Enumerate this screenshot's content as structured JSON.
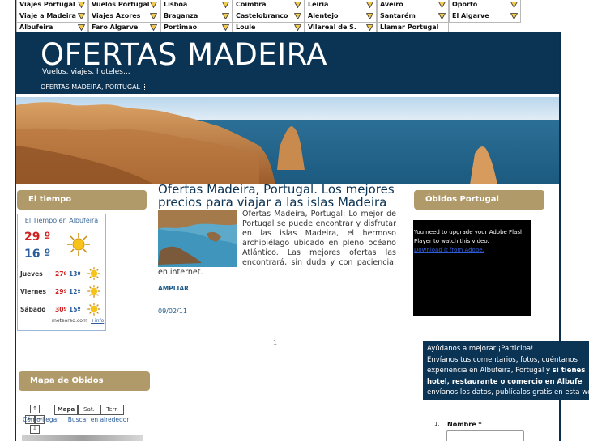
{
  "nav": {
    "rows": [
      [
        "Viajes Portugal",
        "Vuelos Portugal",
        "Lisboa",
        "Coimbra",
        "Leiria",
        "Aveiro",
        "Oporto"
      ],
      [
        "Viaje a Madeira",
        "Viajes Azores",
        "Braganza",
        "Castelobranco",
        "Alentejo",
        "Santarém",
        "El Algarve"
      ],
      [
        "Albufeira",
        "Faro Algarve",
        "Portimao",
        "Loule",
        "Vilareal de S. Antonio",
        "Llamar Portugal",
        ""
      ]
    ],
    "arrow_icon": "dropdown-triangle-icon"
  },
  "header": {
    "title": "OFERTAS MADEIRA",
    "tagline": "Vuelos, viajes, hoteles...",
    "breadcrumb": "OFERTAS MADEIRA, PORTUGAL"
  },
  "colors": {
    "header_bg": "#0b3354",
    "sidebar_head": "#b09a6a",
    "link": "#1e5a88"
  },
  "weather": {
    "heading": "El tiempo",
    "title": "El Tiempo en Albufeira",
    "max": "29 º",
    "min": "16 º",
    "days": [
      {
        "day": "Jueves",
        "hi": "27º",
        "lo": "13º"
      },
      {
        "day": "Viernes",
        "hi": "29º",
        "lo": "12º"
      },
      {
        "day": "Sábado",
        "hi": "30º",
        "lo": "15º"
      }
    ],
    "credit": "meteored.com",
    "link": "+info"
  },
  "map": {
    "heading": "Mapa de Obidos",
    "types": [
      "Mapa",
      "Sat.",
      "Terr."
    ],
    "links": [
      "Cómo llegar",
      "Buscar en alrededor"
    ]
  },
  "post": {
    "title": "Ofertas Madeira, Portugal. Los mejores precios para viajar a las islas Madeira",
    "body": "Ofertas Madeira, Portugal: Lo mejor de Portugal se puede encontrar y disfrutar en las islas Madeira, el hermoso archipiélago ubicado en pleno océano Atlántico. Las mejores ofertas las encontrará, sin duda y con paciencia, en internet.",
    "more": "AMPLIAR",
    "date": "09/02/11",
    "page": "1"
  },
  "right": {
    "heading": "Óbidos Portugal",
    "flash_text": "You need to upgrade your Adobe Flash Player to watch this video.",
    "flash_link": "Download it from Adobe."
  },
  "participa": {
    "line1": "Ayúdanos a mejorar ¡Participa!",
    "line2": "Envíanos tus comentarios, fotos, cuéntanos",
    "line3_a": "experiencia en Albufeira, Portugal y",
    "line3_b": "si tienes",
    "line4": "hotel, restaurante o comercio en Albufe",
    "line5": "envíanos los datos, publícalos gratis en esta web"
  },
  "form": {
    "num": "1.",
    "label": "Nombre *"
  }
}
